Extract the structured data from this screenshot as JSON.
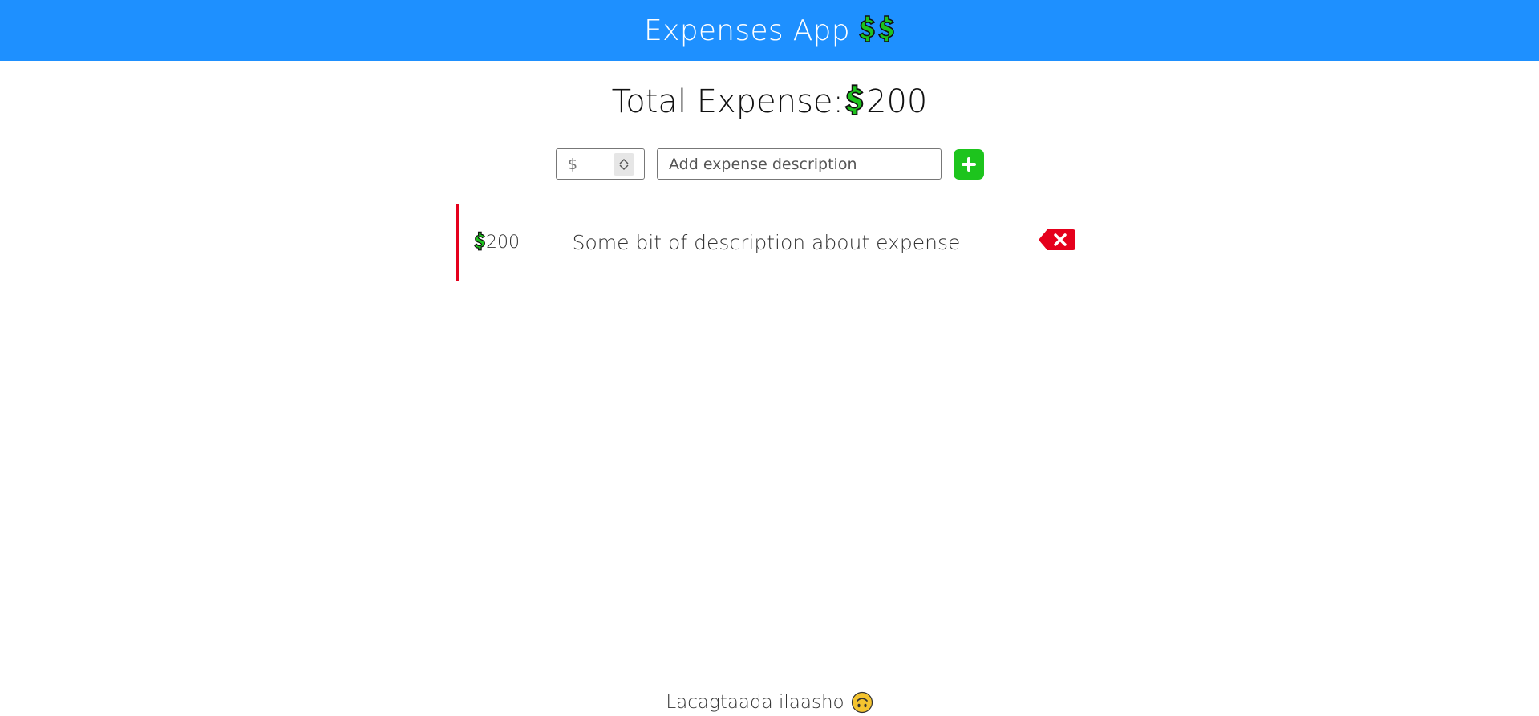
{
  "header": {
    "title": "Expenses App",
    "icons": [
      "dollar-icon",
      "dollar-icon"
    ],
    "background": "#1e90ff"
  },
  "total": {
    "label": "Total Expense:",
    "currency_icon": "dollar-icon",
    "amount": "200"
  },
  "form": {
    "amount_placeholder": "$",
    "description_placeholder": "Add expense description",
    "add_icon": "plus-icon",
    "add_color": "#1dc41d"
  },
  "expenses": [
    {
      "amount": "200",
      "currency_icon": "dollar-icon",
      "description": "Some bit of description about expense",
      "delete_icon": "backspace-delete-icon",
      "accent": "#e5001c"
    }
  ],
  "footer": {
    "text": "Lacagtaada ilaasho",
    "emoji_icon": "upside-down-smiley-icon"
  }
}
